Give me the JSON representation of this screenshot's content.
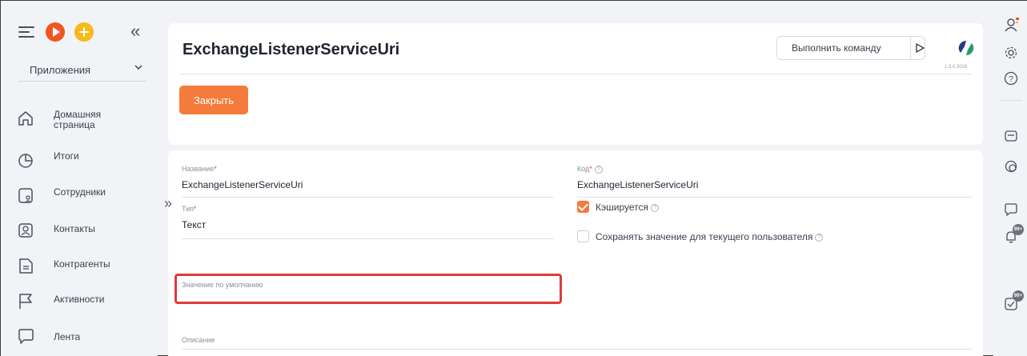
{
  "sidebar": {
    "app_select": "Приложения",
    "items": [
      {
        "label_line1": "Домашняя",
        "label_line2": "страница",
        "icon": "home-icon"
      },
      {
        "label_line1": "Итоги",
        "label_line2": "",
        "icon": "pie-chart-icon"
      },
      {
        "label_line1": "Сотрудники",
        "label_line2": "",
        "icon": "employees-icon"
      },
      {
        "label_line1": "Контакты",
        "label_line2": "",
        "icon": "contact-icon"
      },
      {
        "label_line1": "Контрагенты",
        "label_line2": "",
        "icon": "document-icon"
      },
      {
        "label_line1": "Активности",
        "label_line2": "",
        "icon": "flag-icon"
      },
      {
        "label_line1": "Лента",
        "label_line2": "",
        "icon": "chat-icon"
      }
    ]
  },
  "header": {
    "title": "ExchangeListenerServiceUri",
    "command_placeholder": "Выполнить команду",
    "version": "1.3.0.3026",
    "close_label": "Закрыть"
  },
  "form": {
    "name_label": "Название",
    "name_value": "ExchangeListenerServiceUri",
    "code_label": "Код",
    "code_value": "ExchangeListenerServiceUri",
    "type_label": "Тип",
    "type_value": "Текст",
    "cached_label": "Кэшируется",
    "cached_checked": true,
    "save_for_user_label": "Сохранять значение для текущего пользователя",
    "save_for_user_checked": false,
    "default_value_label": "Значение по умолчанию",
    "default_value": "",
    "description_label": "Описание",
    "description_value": "",
    "required_mark": "*",
    "help_mark": "?"
  },
  "rail": {
    "badge_notifications": "99+",
    "badge_tasks": "99+"
  },
  "colors": {
    "accent": "#f47b3c",
    "highlight": "#e03a3a",
    "background": "#f1f3f6"
  }
}
